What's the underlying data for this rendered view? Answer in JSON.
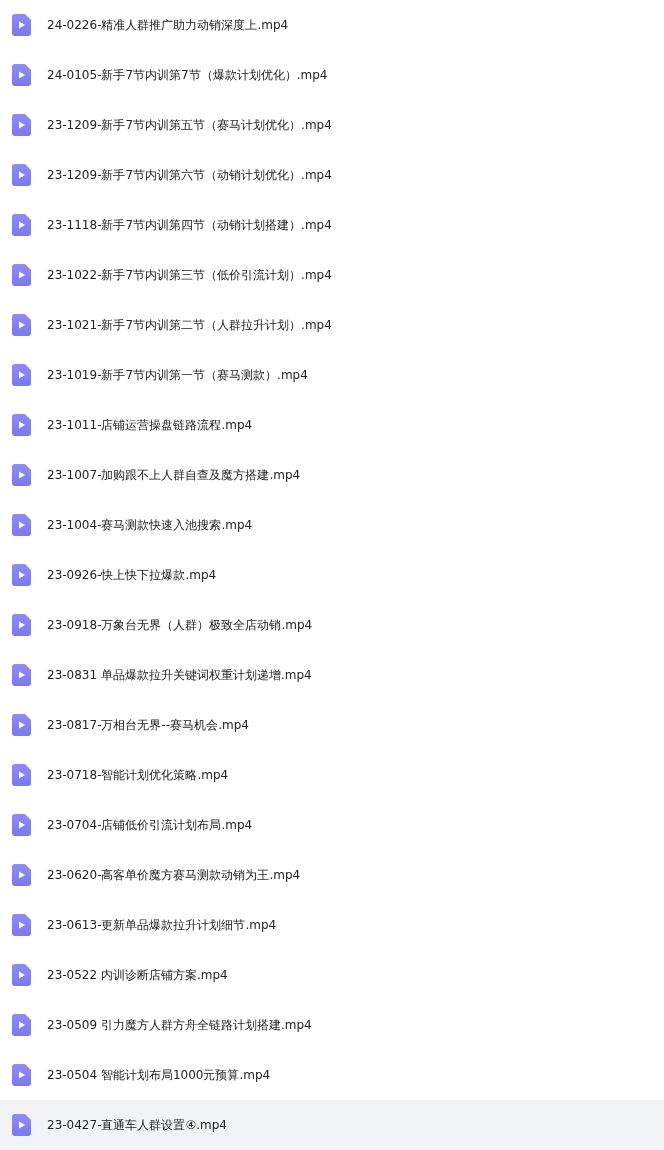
{
  "files": [
    {
      "name": "24-0226-精准人群推广助力动销深度上.mp4",
      "selected": false
    },
    {
      "name": "24-0105-新手7节内训第7节（爆款计划优化）.mp4",
      "selected": false
    },
    {
      "name": "23-1209-新手7节内训第五节（赛马计划优化）.mp4",
      "selected": false
    },
    {
      "name": "23-1209-新手7节内训第六节（动销计划优化）.mp4",
      "selected": false
    },
    {
      "name": "23-1118-新手7节内训第四节（动销计划搭建）.mp4",
      "selected": false
    },
    {
      "name": "23-1022-新手7节内训第三节（低价引流计划）.mp4",
      "selected": false
    },
    {
      "name": "23-1021-新手7节内训第二节（人群拉升计划）.mp4",
      "selected": false
    },
    {
      "name": "23-1019-新手7节内训第一节（赛马测款）.mp4",
      "selected": false
    },
    {
      "name": "23-1011-店铺运营操盘链路流程.mp4",
      "selected": false
    },
    {
      "name": "23-1007-加购跟不上人群自查及魔方搭建.mp4",
      "selected": false
    },
    {
      "name": "23-1004-赛马测款快速入池搜索.mp4",
      "selected": false
    },
    {
      "name": "23-0926-快上快下拉爆款.mp4",
      "selected": false
    },
    {
      "name": "23-0918-万象台无界（人群）极致全店动销.mp4",
      "selected": false
    },
    {
      "name": "23-0831 单品爆款拉升关键词权重计划递增.mp4",
      "selected": false
    },
    {
      "name": "23-0817-万相台无界--赛马机会.mp4",
      "selected": false
    },
    {
      "name": "23-0718-智能计划优化策略.mp4",
      "selected": false
    },
    {
      "name": "23-0704-店铺低价引流计划布局.mp4",
      "selected": false
    },
    {
      "name": "23-0620-高客单价魔方赛马测款动销为王.mp4",
      "selected": false
    },
    {
      "name": "23-0613-更新单品爆款拉升计划细节.mp4",
      "selected": false
    },
    {
      "name": "23-0522 内训诊断店铺方案.mp4",
      "selected": false
    },
    {
      "name": "23-0509 引力魔方人群方舟全链路计划搭建.mp4",
      "selected": false
    },
    {
      "name": "23-0504 智能计划布局1000元预算.mp4",
      "selected": false
    },
    {
      "name": "23-0427-直通车人群设置④.mp4",
      "selected": true
    }
  ]
}
